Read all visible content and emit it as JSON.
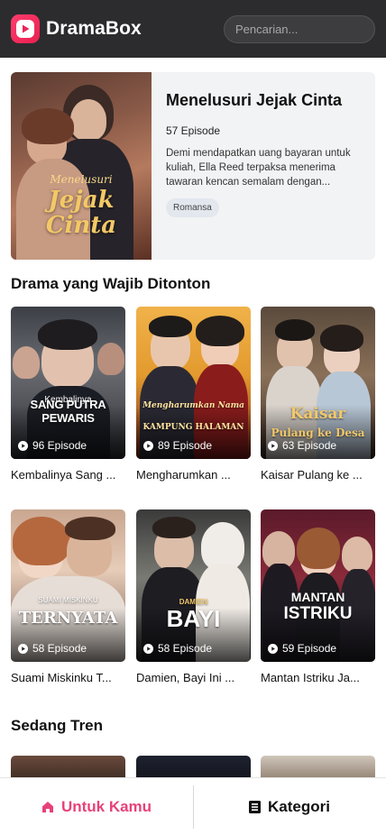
{
  "header": {
    "app_name": "DramaBox",
    "search_placeholder": "Pencarian..."
  },
  "featured": {
    "title": "Menelusuri Jejak Cinta",
    "episodes": "57 Episode",
    "description": "Demi mendapatkan uang bayaran untuk kuliah, Ella Reed terpaksa menerima tawaran kencan semalam dengan...",
    "tag": "Romansa",
    "poster_text_top": "Menelusuri",
    "poster_text_main": "Jejak Cinta"
  },
  "sections": {
    "must_watch_title": "Drama yang Wajib Ditonton",
    "trending_title": "Sedang Tren"
  },
  "must_watch": [
    {
      "name": "Kembalinya Sang ...",
      "episodes": "96 Episode",
      "poster_title": "SANG PUTRA PEWARIS",
      "poster_sub": "Kembalinya"
    },
    {
      "name": "Mengharumkan ...",
      "episodes": "89 Episode",
      "poster_title": "KAMPUNG HALAMAN",
      "poster_sub": "Mengharumkan Nama"
    },
    {
      "name": "Kaisar Pulang ke ...",
      "episodes": "63 Episode",
      "poster_title": "Pulang ke Desa",
      "poster_sub": "Kaisar"
    },
    {
      "name": "Suami Miskinku T...",
      "episodes": "58 Episode",
      "poster_title": "TERNYATA",
      "poster_sub": "SUAMI MISKINKU"
    },
    {
      "name": "Damien, Bayi Ini ...",
      "episodes": "58 Episode",
      "poster_title": "BAYI",
      "poster_sub": "DAMIEN"
    },
    {
      "name": "Mantan Istriku Ja...",
      "episodes": "59 Episode",
      "poster_title": "ISTRIKU",
      "poster_sub": "MANTAN"
    }
  ],
  "bottom_nav": {
    "for_you": "Untuk Kamu",
    "category": "Kategori"
  },
  "colors": {
    "brand": "#e8417a",
    "header_bg": "#2c2c2e"
  }
}
